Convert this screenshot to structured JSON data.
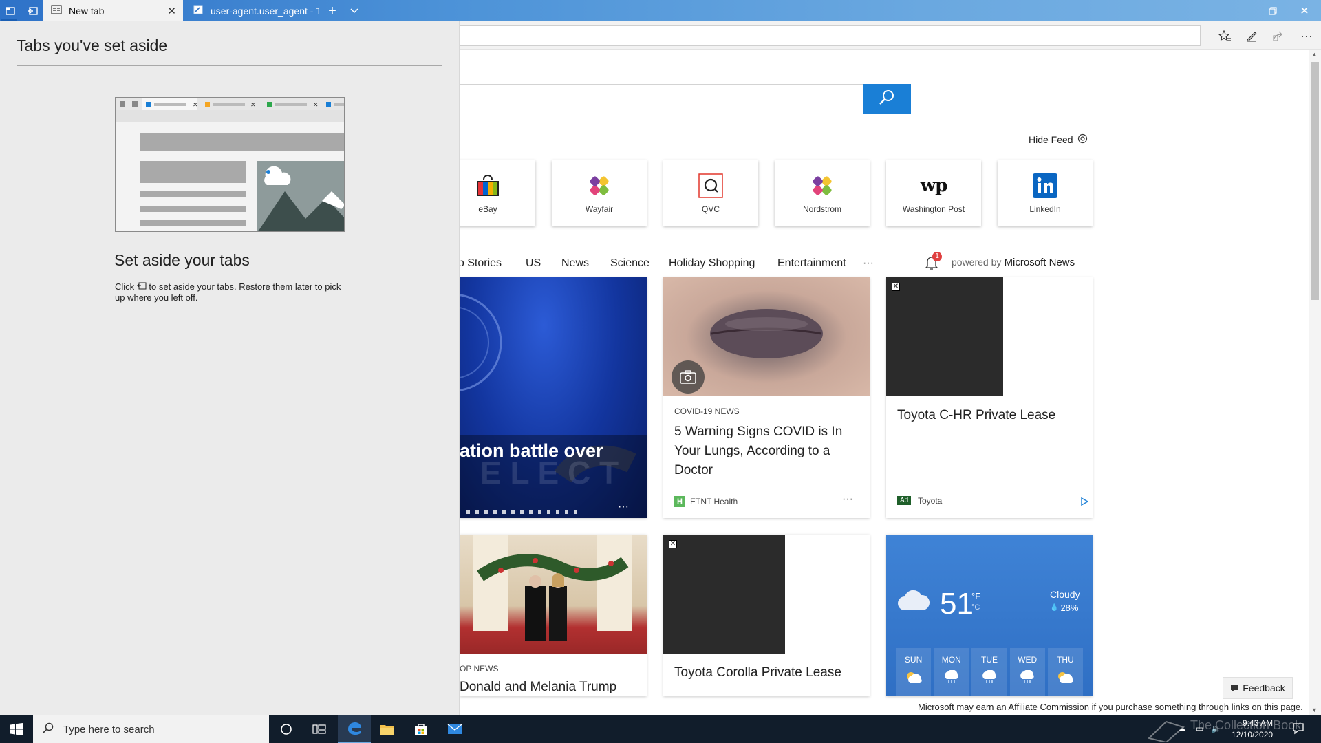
{
  "browser": {
    "tabs": [
      {
        "label": "New tab",
        "active": true
      },
      {
        "label": "user-agent.user_agent - The",
        "active": false
      }
    ],
    "address": "",
    "window_controls": [
      "minimize-icon",
      "restore-icon",
      "close-icon"
    ]
  },
  "aside_panel": {
    "title": "Tabs you've set aside",
    "heading": "Set aside your tabs",
    "desc_before": "Click",
    "desc_after": "to set aside your tabs. Restore them later to pick up where you left off."
  },
  "newtab": {
    "search_placeholder": "",
    "hide_feed": "Hide Feed",
    "top_sites": [
      "eBay",
      "Wayfair",
      "QVC",
      "Nordstrom",
      "Washington Post",
      "LinkedIn"
    ],
    "categories": [
      "op Stories",
      "US",
      "News",
      "Science",
      "Holiday Shopping",
      "Entertainment"
    ],
    "more": "···",
    "notif_count": "1",
    "powered_by_prefix": "powered by",
    "powered_by_brand": "Microsoft News",
    "cards": {
      "hero_title": "ation battle over",
      "covid_category": "COVID-19 NEWS",
      "covid_title": "5 Warning Signs COVID is In Your Lungs, According to a Doctor",
      "covid_source": "ETNT Health",
      "covid_source_badge": "H",
      "ad1_title": "Toyota C-HR Private Lease",
      "ad_badge": "Ad",
      "ad_source": "Toyota",
      "trump_category": "OP NEWS",
      "trump_title": "Donald and Melania Trump",
      "ad2_title": "Toyota Corolla Private Lease"
    },
    "weather": {
      "temp": "51",
      "unit_f": "°F",
      "unit_c": "°C",
      "condition": "Cloudy",
      "precip": "28%",
      "days": [
        "SUN",
        "MON",
        "TUE",
        "WED",
        "THU"
      ]
    },
    "feedback": "Feedback",
    "affiliate": "Microsoft may earn an Affiliate Commission if you purchase something through links on this page."
  },
  "taskbar": {
    "search_placeholder": "Type here to search",
    "time": "9:43 AM",
    "date": "12/10/2020",
    "watermark": "The Collection Book"
  },
  "colors": {
    "tabbar": "#2e72c8",
    "search_button": "#1a7fd6",
    "weather_card": "#3a7fd0",
    "taskbar": "#111d2b"
  }
}
